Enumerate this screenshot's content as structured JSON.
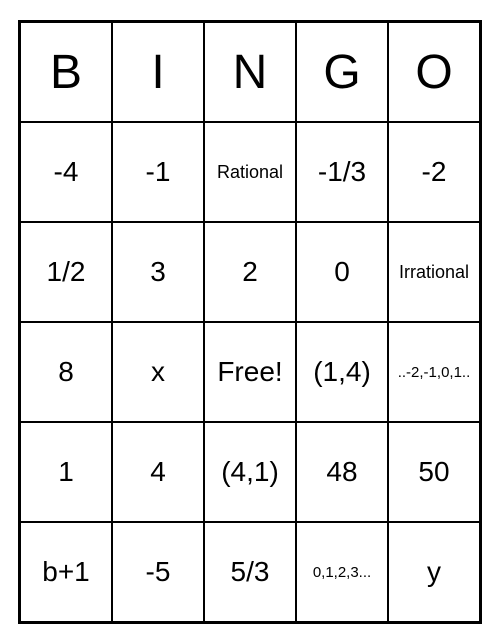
{
  "headers": [
    "B",
    "I",
    "N",
    "G",
    "O"
  ],
  "grid": [
    [
      {
        "text": "-4",
        "cls": ""
      },
      {
        "text": "-1",
        "cls": ""
      },
      {
        "text": "Rational",
        "cls": "small-text"
      },
      {
        "text": "-1/3",
        "cls": ""
      },
      {
        "text": "-2",
        "cls": ""
      }
    ],
    [
      {
        "text": "1/2",
        "cls": ""
      },
      {
        "text": "3",
        "cls": ""
      },
      {
        "text": "2",
        "cls": ""
      },
      {
        "text": "0",
        "cls": ""
      },
      {
        "text": "Irrational",
        "cls": "small-text"
      }
    ],
    [
      {
        "text": "8",
        "cls": ""
      },
      {
        "text": "x",
        "cls": ""
      },
      {
        "text": "Free!",
        "cls": ""
      },
      {
        "text": "(1,4)",
        "cls": ""
      },
      {
        "text": "..-2,-1,0,1..",
        "cls": "smaller-text"
      }
    ],
    [
      {
        "text": "1",
        "cls": ""
      },
      {
        "text": "4",
        "cls": ""
      },
      {
        "text": "(4,1)",
        "cls": ""
      },
      {
        "text": "48",
        "cls": ""
      },
      {
        "text": "50",
        "cls": ""
      }
    ],
    [
      {
        "text": "b+1",
        "cls": ""
      },
      {
        "text": "-5",
        "cls": ""
      },
      {
        "text": "5/3",
        "cls": ""
      },
      {
        "text": "0,1,2,3...",
        "cls": "smaller-text"
      },
      {
        "text": "y",
        "cls": ""
      }
    ]
  ]
}
